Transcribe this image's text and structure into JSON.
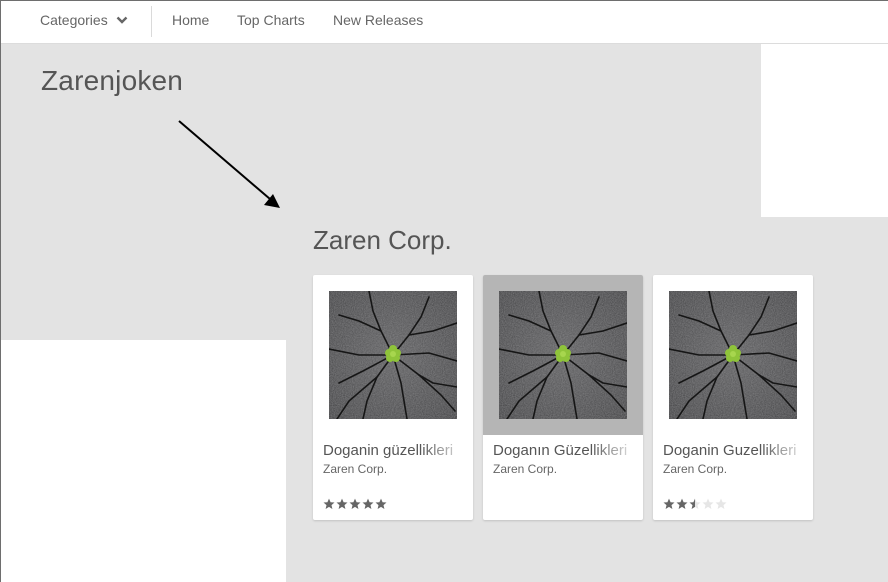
{
  "nav": {
    "categories_label": "Categories",
    "items": [
      {
        "label": "Home"
      },
      {
        "label": "Top Charts"
      },
      {
        "label": "New Releases"
      }
    ]
  },
  "page": {
    "developer_title": "Zarenjoken",
    "section_title": "Zaren Corp."
  },
  "cards": [
    {
      "name": "Doganin güzellikleri",
      "developer": "Zaren Corp.",
      "rating_stars": 5,
      "max_stars": 5,
      "highlighted": false
    },
    {
      "name": "Doganın Güzellikleri",
      "developer": "Zaren Corp.",
      "rating_stars": null,
      "max_stars": 5,
      "highlighted": true
    },
    {
      "name": "Doganin Guzellikleri",
      "developer": "Zaren Corp.",
      "rating_stars": 2.5,
      "max_stars": 5,
      "highlighted": false
    }
  ],
  "colors": {
    "background_gray": "#e3e3e3",
    "text": "#555555",
    "star_filled": "#666666",
    "star_empty": "#e6e6e6",
    "card_highlight": "#b5b5b5"
  },
  "icons": {
    "categories": "chevron-down-icon",
    "annotation": "arrow-icon",
    "rating": "star-icon",
    "thumbnail": "cracked-asphalt-sprout-image"
  }
}
